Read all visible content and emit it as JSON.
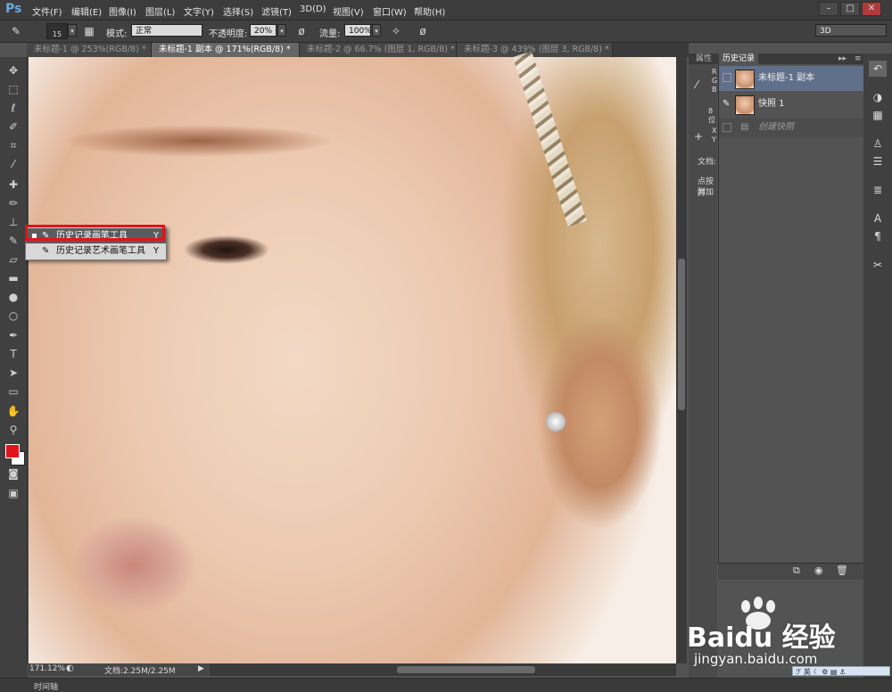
{
  "menubar": {
    "logo": "Ps",
    "items": [
      "文件(F)",
      "编辑(E)",
      "图像(I)",
      "图层(L)",
      "文字(Y)",
      "选择(S)",
      "滤镜(T)",
      "3D(D)",
      "视图(V)",
      "窗口(W)",
      "帮助(H)"
    ],
    "window_buttons": [
      "–",
      "□",
      "✕"
    ]
  },
  "options": {
    "brush_size": "15",
    "mode_label": "模式:",
    "mode_value": "正常",
    "opacity_label": "不透明度:",
    "opacity_value": "20%",
    "flow_label": "流量:",
    "flow_value": "100%",
    "workspace": "3D"
  },
  "tabs": [
    "未标题-1 @ 253%(RGB/8) *",
    "未标题-1 副本 @ 171%(RGB/8) *",
    "未标题-2 @ 66.7% (图层 1, RGB/8) *",
    "未标题-3 @ 439% (图层 3, RGB/8) *"
  ],
  "flyout": {
    "items": [
      {
        "label": "历史记录画笔工具",
        "shortcut": "Y"
      },
      {
        "label": "历史记录艺术画笔工具",
        "shortcut": "Y"
      }
    ]
  },
  "panels": {
    "tab_properties": "属性",
    "tab_history": "历史记录",
    "history_items": [
      "未标题-1 副本",
      "快照 1",
      "创建快照"
    ],
    "info_letters": [
      "R",
      "G",
      "B",
      "8 位",
      "X",
      "Y"
    ],
    "doc_label": "文档:",
    "hint_lines": [
      "点按并",
      "附加"
    ]
  },
  "status": {
    "zoom": "171.12%",
    "doc_info": "文档:2.25M/2.25M",
    "timeline": "时间轴"
  },
  "watermark": {
    "brand": "Baidu 经验",
    "url": "jingyan.baidu.com",
    "ime": "英"
  },
  "colors": {
    "foreground": "#e0141b",
    "background": "#ffffff",
    "highlight": "#e0141b"
  }
}
